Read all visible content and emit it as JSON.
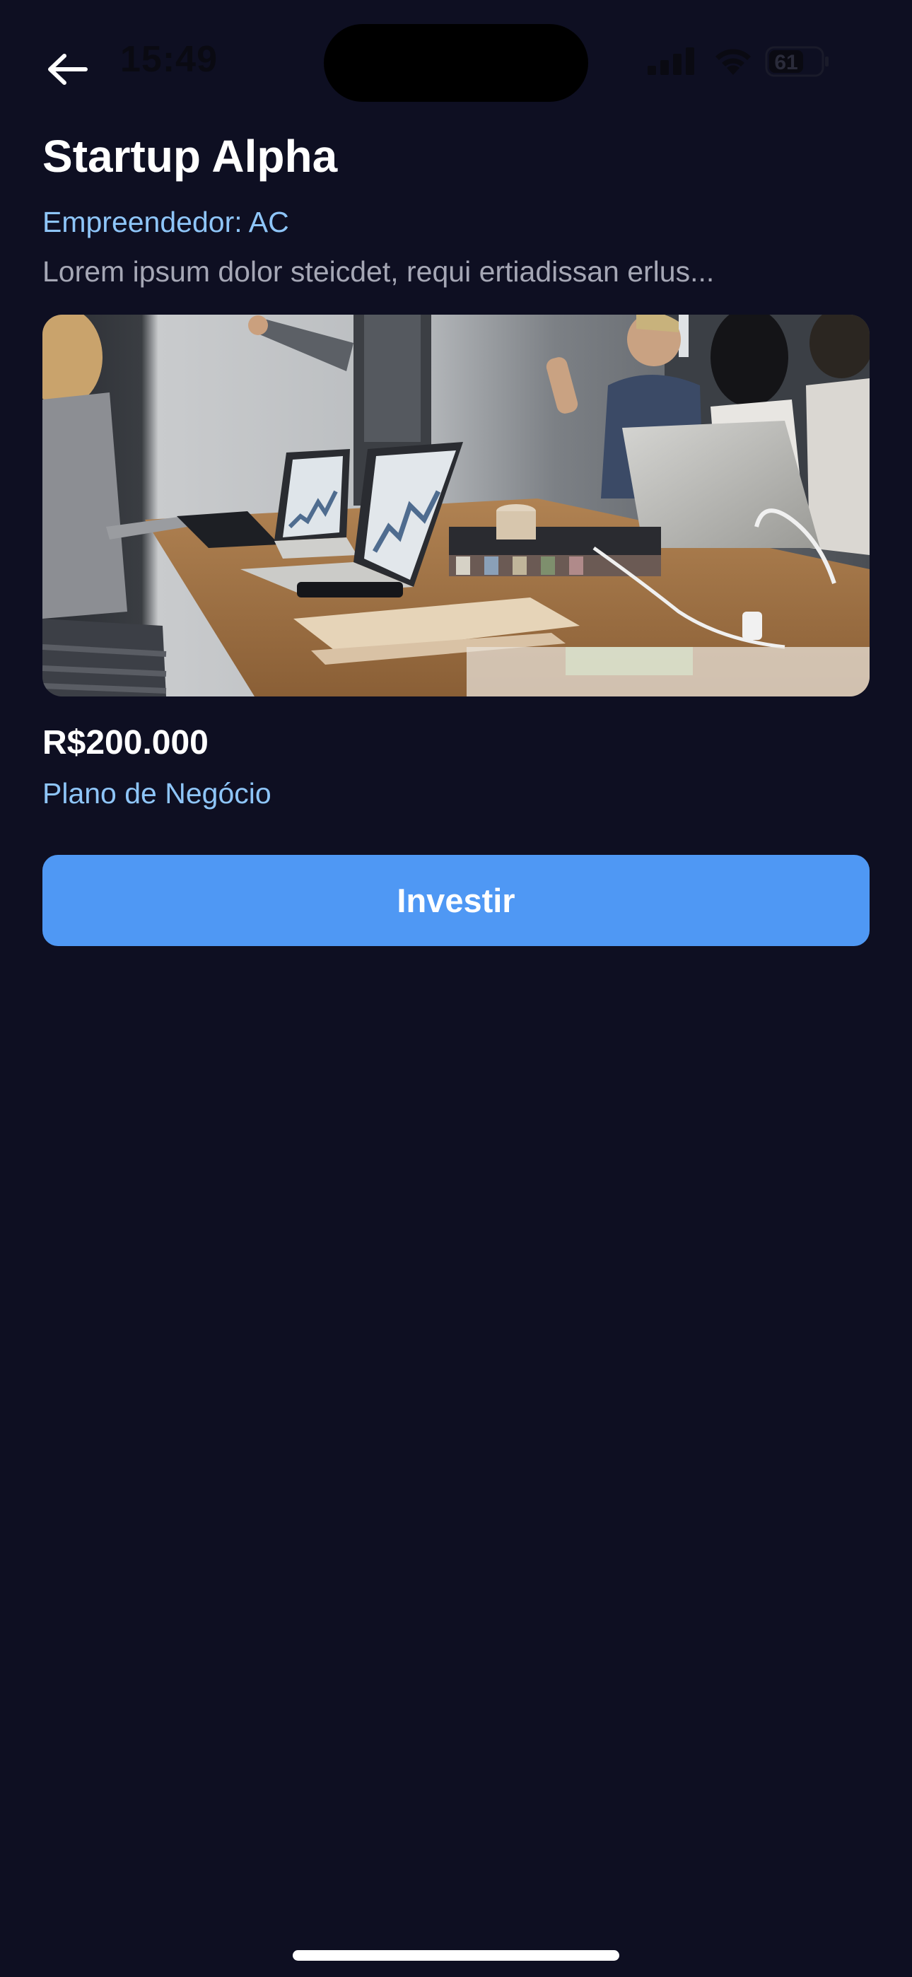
{
  "status_bar": {
    "time": "15:49",
    "battery_level": "61"
  },
  "header": {
    "back_icon": "arrow-left-icon"
  },
  "startup": {
    "name": "Startup Alpha",
    "entrepreneur": "Empreendedor: AC",
    "description": "Lorem ipsum dolor steicdet, requi ertiadissan erlus...",
    "image": "team-meeting-photo",
    "amount": "R$200.000",
    "business_plan_link": "Plano de Negócio"
  },
  "actions": {
    "invest_label": "Investir"
  },
  "colors": {
    "background": "#0e0f22",
    "accent": "#4f98f4",
    "link": "#8ec5f8",
    "muted_text": "#a5a7b5"
  }
}
